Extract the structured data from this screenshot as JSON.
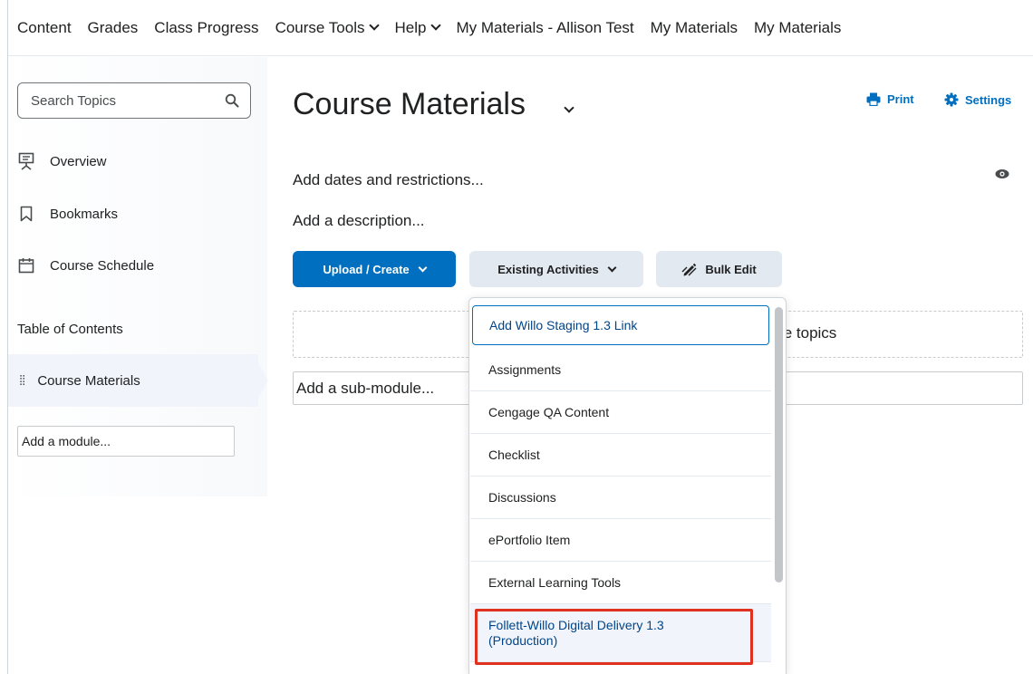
{
  "topnav": {
    "items": [
      {
        "label": "Content",
        "dropdown": false
      },
      {
        "label": "Grades",
        "dropdown": false
      },
      {
        "label": "Class Progress",
        "dropdown": false
      },
      {
        "label": "Course Tools",
        "dropdown": true
      },
      {
        "label": "Help",
        "dropdown": true
      },
      {
        "label": "My Materials - Allison Test",
        "dropdown": false
      },
      {
        "label": "My Materials",
        "dropdown": false
      },
      {
        "label": "My Materials",
        "dropdown": false
      }
    ]
  },
  "sidebar": {
    "search_placeholder": "Search Topics",
    "links": [
      {
        "label": "Overview",
        "icon": "presentation-icon"
      },
      {
        "label": "Bookmarks",
        "icon": "bookmark-icon"
      },
      {
        "label": "Course Schedule",
        "icon": "calendar-icon"
      }
    ],
    "toc_heading": "Table of Contents",
    "module_label": "Course Materials",
    "add_module_placeholder": "Add a module..."
  },
  "main": {
    "title": "Course Materials",
    "print_label": "Print",
    "settings_label": "Settings",
    "add_dates": "Add dates and restrictions...",
    "add_description": "Add a description...",
    "upload_create": "Upload / Create",
    "existing_activities": "Existing Activities",
    "bulk_edit": "Bulk Edit",
    "drop_zone_text": "te topics",
    "add_submodule": "Add a sub-module..."
  },
  "dropdown": {
    "items": [
      {
        "label": "Add Willo Staging 1.3 Link",
        "state": "focused"
      },
      {
        "label": "Assignments",
        "state": "normal"
      },
      {
        "label": "Cengage QA Content",
        "state": "normal"
      },
      {
        "label": "Checklist",
        "state": "normal"
      },
      {
        "label": "Discussions",
        "state": "normal"
      },
      {
        "label": "ePortfolio Item",
        "state": "normal"
      },
      {
        "label": "External Learning Tools",
        "state": "normal"
      },
      {
        "label": "Follett-Willo Digital Delivery 1.3 (Production)",
        "state": "hovered-highlighted"
      }
    ]
  },
  "colors": {
    "primary": "#006fbf",
    "secondary_button": "#e3e9f1",
    "highlight_border": "#e0301e",
    "text": "#202122"
  }
}
